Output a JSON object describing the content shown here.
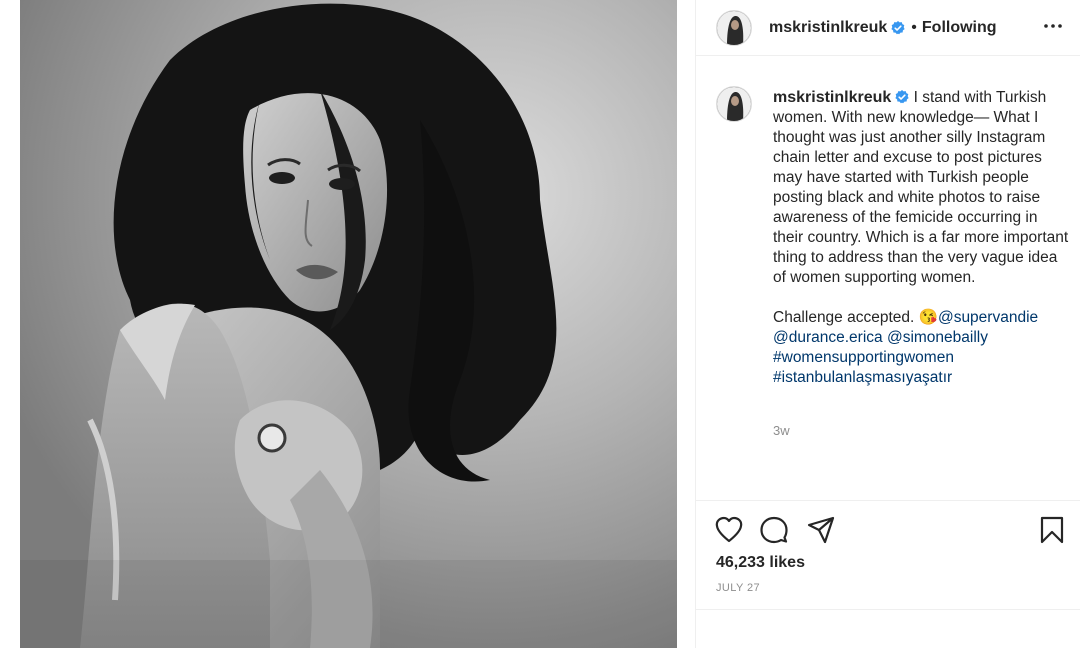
{
  "post": {
    "username": "mskristinlkreuk",
    "follow_separator": "•",
    "follow_status": "Following",
    "caption": {
      "p1": "I stand with Turkish women. With new knowledge— What I thought was just another silly Instagram chain letter and excuse to post pictures may have started with Turkish people posting black and white photos to raise awareness of the femicide occurring in their country. Which is a far more important thing to address than the very vague idea of women supporting women.",
      "challenge": "Challenge accepted. ",
      "emoji": "😘",
      "mentions": [
        "@supervandie",
        "@durance.erica",
        "@simonebailly"
      ],
      "hashtags": [
        "#womensupportingwomen",
        "#istanbulanlaşmasıyaşatır"
      ]
    },
    "time_ago": "3w",
    "likes": "46,233 likes",
    "date": "JULY 27"
  },
  "icons": {
    "verified": "verified-badge-icon",
    "more": "more-options-icon",
    "like": "heart-icon",
    "comment": "comment-icon",
    "share": "paper-plane-icon",
    "save": "bookmark-icon"
  },
  "colors": {
    "verified_blue": "#3897f0",
    "link": "#00376b",
    "muted": "#8e8e8e",
    "text": "#262626",
    "divider": "#efefef"
  }
}
